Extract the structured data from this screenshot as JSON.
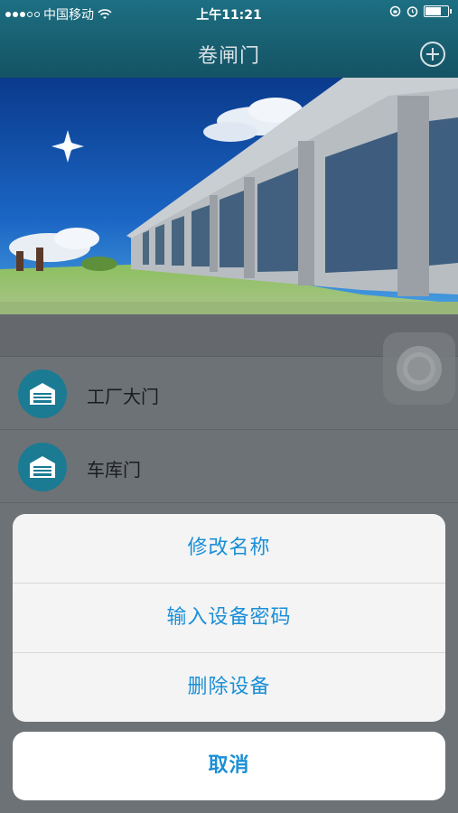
{
  "status_bar": {
    "carrier": "中国移动",
    "time": "上午11:21",
    "battery_level": 0.75
  },
  "nav": {
    "title": "卷闸门",
    "add_icon": "plus-circle-icon"
  },
  "devices": [
    {
      "name": "工厂大门",
      "icon": "garage-door-icon"
    },
    {
      "name": "车库门",
      "icon": "garage-door-icon"
    }
  ],
  "action_sheet": {
    "options": [
      "修改名称",
      "输入设备密码",
      "删除设备"
    ],
    "cancel": "取消"
  },
  "colors": {
    "nav_bar": "#1a6577",
    "accent": "#1a8fd6",
    "device_icon": "#1a7b93"
  }
}
